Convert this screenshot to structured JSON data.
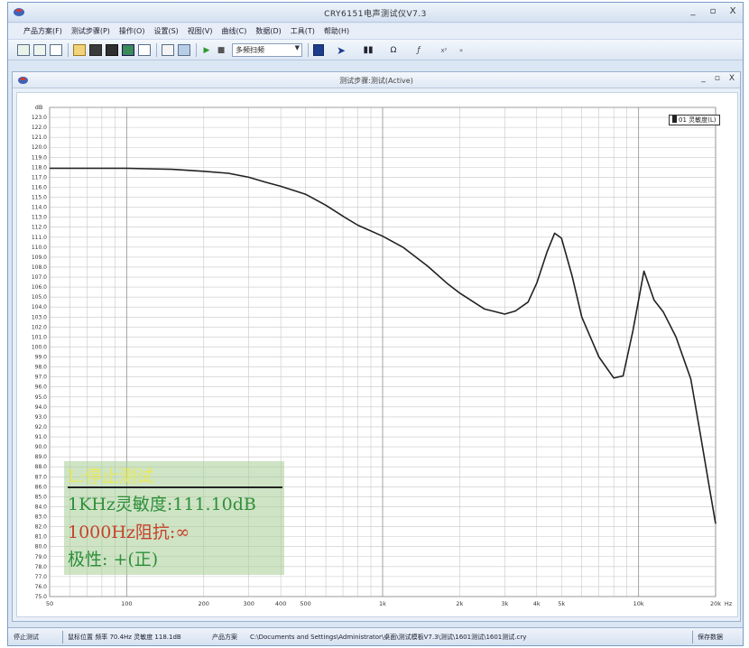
{
  "window": {
    "title": "CRY6151电声测试仪V7.3",
    "controls": [
      "_",
      "▫",
      "X"
    ]
  },
  "menu": {
    "items": [
      "产品方案(F)",
      "测试步骤(P)",
      "操作(O)",
      "设置(S)",
      "视图(V)",
      "曲线(C)",
      "数据(D)",
      "工具(T)",
      "帮助(H)"
    ]
  },
  "toolbar": {
    "mode_select": "多频扫频",
    "glyphs": [
      "▶",
      "■",
      "Ω"
    ]
  },
  "child_window": {
    "title": "测试步骤:测试(Active)",
    "controls": [
      "_",
      "▫",
      "X"
    ]
  },
  "legend": {
    "button_label": "01 灵敏度(L)"
  },
  "overlay": {
    "line1": "L:停止测试",
    "line2": "1KHz灵敏度:111.10dB",
    "line3": "1000Hz阻抗:∞",
    "line4": "极性: +(正)",
    "colors": {
      "line1": "#e8e85a",
      "line2": "#2f8f3a",
      "line3": "#c8402a",
      "line4": "#2f8f3a"
    }
  },
  "status": {
    "state": "停止测试",
    "cursor": "鼠标位置 频率 70.4Hz 灵敏度 118.1dB",
    "product": "产品方案",
    "path": "C:\\Documents and Settings\\Administrator\\桌面\\测试模板V7.3\\测试\\1601测试\\1601测试.cry",
    "right": "保存数据"
  },
  "chart_data": {
    "type": "line",
    "title": "",
    "xlabel": "Hz",
    "ylabel": "dB",
    "xscale": "log",
    "xlim": [
      50,
      20000
    ],
    "ylim": [
      75,
      124
    ],
    "x_tick_labels": [
      {
        "v": 50,
        "t": "50"
      },
      {
        "v": 100,
        "t": "100"
      },
      {
        "v": 200,
        "t": "200"
      },
      {
        "v": 300,
        "t": "300"
      },
      {
        "v": 400,
        "t": "400"
      },
      {
        "v": 500,
        "t": "500"
      },
      {
        "v": 1000,
        "t": "1k"
      },
      {
        "v": 2000,
        "t": "2k"
      },
      {
        "v": 3000,
        "t": "3k"
      },
      {
        "v": 4000,
        "t": "4k"
      },
      {
        "v": 5000,
        "t": "5k"
      },
      {
        "v": 10000,
        "t": "10k"
      },
      {
        "v": 20000,
        "t": "20k"
      }
    ],
    "y_tick_step": 1,
    "grid": true,
    "legend_position": "top-right",
    "color": "#222222",
    "series": [
      {
        "x": [
          50,
          80,
          100,
          150,
          200,
          250,
          300,
          350,
          400,
          500,
          600,
          700,
          800,
          1000,
          1200,
          1500,
          1800,
          2000,
          2500,
          3000,
          3300,
          3700,
          4000,
          4400,
          4700,
          5000,
          5500,
          6000,
          7000,
          8000,
          8700,
          9500,
          10500,
          11500,
          12500,
          14000,
          16000,
          17500,
          19000,
          20000
        ],
        "y": [
          117.9,
          117.9,
          117.9,
          117.8,
          117.6,
          117.4,
          117.0,
          116.5,
          116.1,
          115.3,
          114.2,
          113.1,
          112.2,
          111.1,
          110.0,
          108.1,
          106.3,
          105.4,
          103.8,
          103.3,
          103.6,
          104.5,
          106.4,
          109.6,
          111.4,
          110.9,
          107.1,
          103.0,
          99.0,
          96.9,
          97.1,
          101.6,
          107.6,
          104.7,
          103.5,
          101.0,
          96.8,
          91.0,
          85.6,
          82.3
        ]
      }
    ]
  }
}
